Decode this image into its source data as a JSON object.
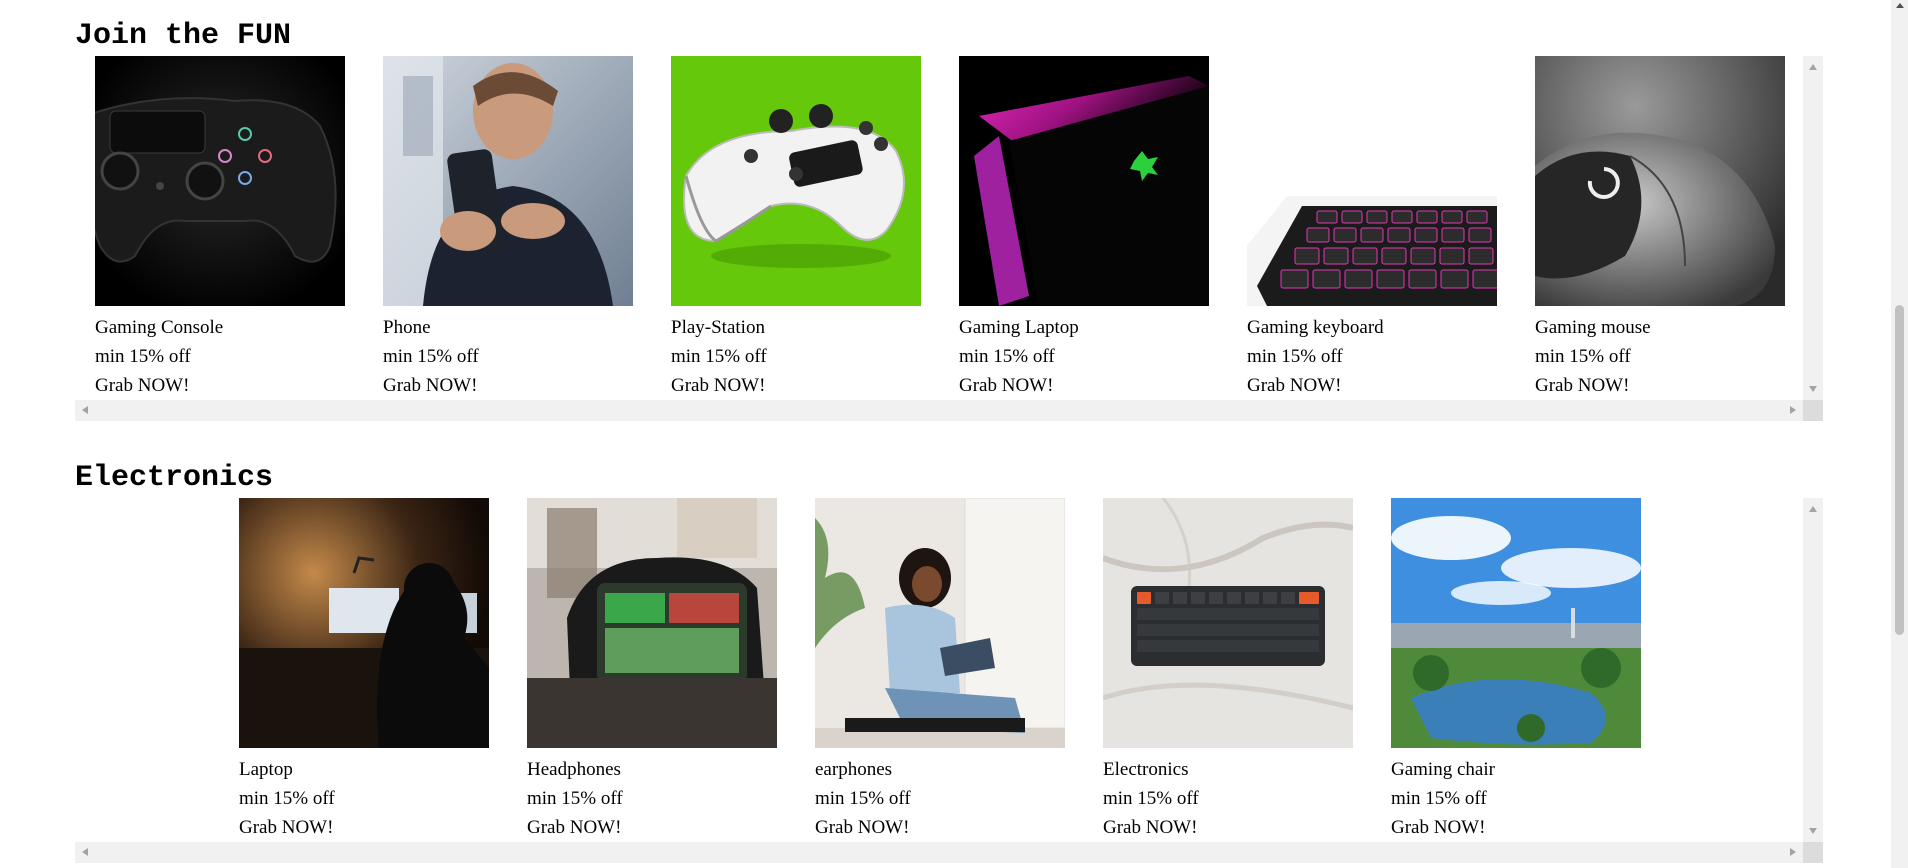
{
  "sections": [
    {
      "title": "Join the FUN",
      "items": [
        {
          "name": "Gaming Console",
          "offer": "min 15% off",
          "cta": "Grab NOW!",
          "image": "gaming-console-photo"
        },
        {
          "name": "Phone",
          "offer": "min 15% off",
          "cta": "Grab NOW!",
          "image": "phone-photo"
        },
        {
          "name": "Play-Station",
          "offer": "min 15% off",
          "cta": "Grab NOW!",
          "image": "playstation-controller-photo"
        },
        {
          "name": "Gaming Laptop",
          "offer": "min 15% off",
          "cta": "Grab NOW!",
          "image": "gaming-laptop-photo"
        },
        {
          "name": "Gaming keyboard",
          "offer": "min 15% off",
          "cta": "Grab NOW!",
          "image": "gaming-keyboard-photo"
        },
        {
          "name": "Gaming mouse",
          "offer": "min 15% off",
          "cta": "Grab NOW!",
          "image": "gaming-mouse-photo"
        }
      ]
    },
    {
      "title": "Electronics",
      "items": [
        {
          "name": "Laptop",
          "offer": "min 15% off",
          "cta": "Grab NOW!",
          "image": "laptop-photo"
        },
        {
          "name": "Headphones",
          "offer": "min 15% off",
          "cta": "Grab NOW!",
          "image": "headphones-photo"
        },
        {
          "name": "earphones",
          "offer": "min 15% off",
          "cta": "Grab NOW!",
          "image": "earphones-photo"
        },
        {
          "name": "Electronics",
          "offer": "min 15% off",
          "cta": "Grab NOW!",
          "image": "electronics-keyboard-photo"
        },
        {
          "name": "Gaming chair",
          "offer": "min 15% off",
          "cta": "Grab NOW!",
          "image": "gaming-chair-photo"
        }
      ]
    }
  ]
}
